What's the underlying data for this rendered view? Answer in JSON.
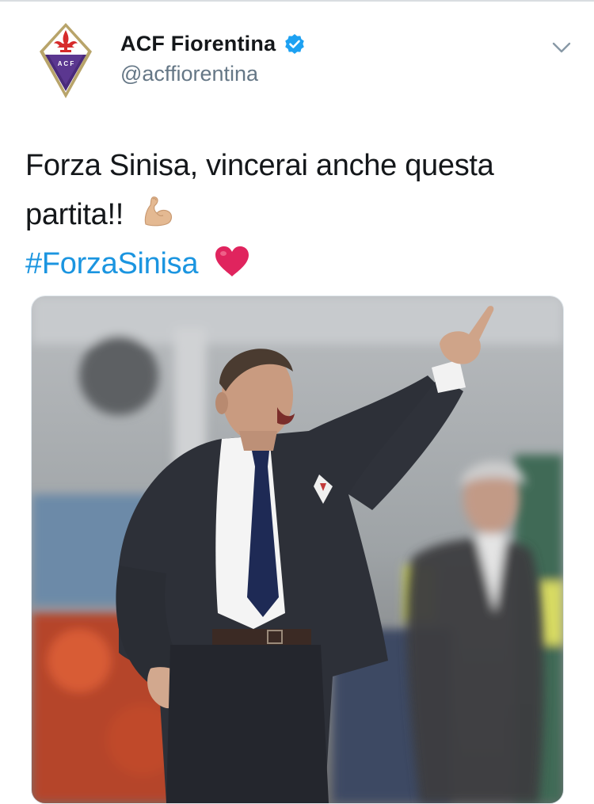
{
  "account": {
    "display_name": "ACF Fiorentina",
    "handle": "@acffiorentina",
    "verified": true,
    "avatar_icon": "fiorentina-crest-icon",
    "logo_text": "A C F"
  },
  "tweet": {
    "line1": "Forza Sinisa, vincerai anche questa",
    "line2": "partita!!",
    "hashtag": "#ForzaSinisa",
    "emojis": [
      "flexed-biceps-icon",
      "red-heart-icon"
    ]
  },
  "media": {
    "type": "photo",
    "icon": "tweet-photo"
  },
  "colors": {
    "text": "#14171a",
    "secondary": "#657786",
    "link": "#1b95e0",
    "verified": "#1da1f2",
    "heart": "#e0245e"
  }
}
